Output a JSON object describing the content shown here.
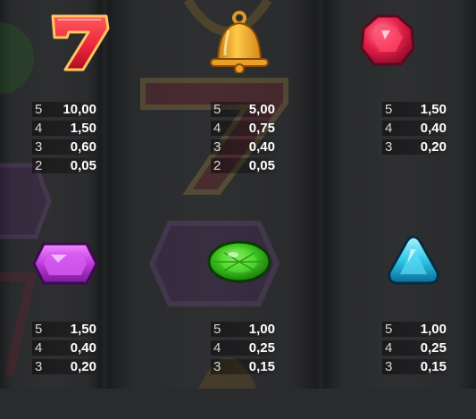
{
  "paytable": {
    "symbols": [
      {
        "symbol": "seven-icon",
        "payouts": [
          {
            "count": "5",
            "value": "10,00"
          },
          {
            "count": "4",
            "value": "1,50"
          },
          {
            "count": "3",
            "value": "0,60"
          },
          {
            "count": "2",
            "value": "0,05"
          }
        ]
      },
      {
        "symbol": "bell-icon",
        "payouts": [
          {
            "count": "5",
            "value": "5,00"
          },
          {
            "count": "4",
            "value": "0,75"
          },
          {
            "count": "3",
            "value": "0,40"
          },
          {
            "count": "2",
            "value": "0,05"
          }
        ]
      },
      {
        "symbol": "red-gem-icon",
        "payouts": [
          {
            "count": "5",
            "value": "1,50"
          },
          {
            "count": "4",
            "value": "0,40"
          },
          {
            "count": "3",
            "value": "0,20"
          }
        ]
      },
      {
        "symbol": "purple-gem-icon",
        "payouts": [
          {
            "count": "5",
            "value": "1,50"
          },
          {
            "count": "4",
            "value": "0,40"
          },
          {
            "count": "3",
            "value": "0,20"
          }
        ]
      },
      {
        "symbol": "green-gem-icon",
        "payouts": [
          {
            "count": "5",
            "value": "1,00"
          },
          {
            "count": "4",
            "value": "0,25"
          },
          {
            "count": "3",
            "value": "0,15"
          }
        ]
      },
      {
        "symbol": "blue-gem-icon",
        "payouts": [
          {
            "count": "5",
            "value": "1,00"
          },
          {
            "count": "4",
            "value": "0,25"
          },
          {
            "count": "3",
            "value": "0,15"
          }
        ]
      }
    ]
  },
  "colors": {
    "background": "#2a2b2d",
    "seven": "#e8233a",
    "bell": "#f0a020",
    "red_gem": "#e8214a",
    "purple_gem": "#c03ae0",
    "green_gem": "#3cc41e",
    "blue_gem": "#2ec8e8"
  }
}
